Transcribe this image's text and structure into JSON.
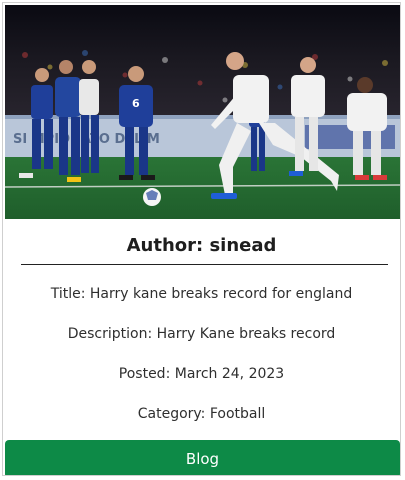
{
  "card": {
    "author_label": "Author: sinead",
    "title_line": "Title: Harry kane breaks record for england",
    "description_line": "Description: Harry Kane breaks record",
    "posted_line": "Posted: March 24, 2023",
    "category_line": "Category: Football",
    "button_label": "Blog"
  },
  "photo": {
    "subject": "football-penalty-kick-photo",
    "jersey_numbers": [
      "6"
    ]
  },
  "colors": {
    "button": "#0d8a47",
    "pitch": "#2f7d3a",
    "italy_blue": "#1f3f9a",
    "england_white": "#f2f2f2"
  }
}
